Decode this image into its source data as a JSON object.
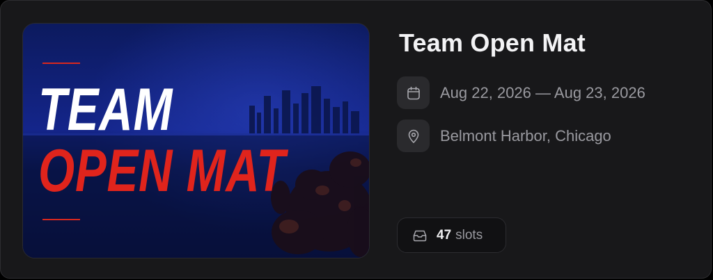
{
  "event": {
    "title": "Team Open Mat",
    "dates": "Aug 22, 2026 — Aug 23, 2026",
    "location": "Belmont Harbor, Chicago",
    "slots_count": "47",
    "slots_label": "slots"
  },
  "poster": {
    "line1": "TEAM",
    "line2": "OPEN MAT",
    "line1_color": "#ffffff",
    "line2_color": "#e0241c",
    "accent_color": "#d9281e",
    "background_color": "#0f1f6b"
  },
  "icons": {
    "dates": "calendar-icon",
    "location": "map-pin-icon",
    "slots": "inbox-icon"
  },
  "colors": {
    "card_background": "#18181a",
    "title": "#f3f3f5",
    "secondary_text": "#9a9aa0",
    "icon_box": "#2a2a2d"
  }
}
